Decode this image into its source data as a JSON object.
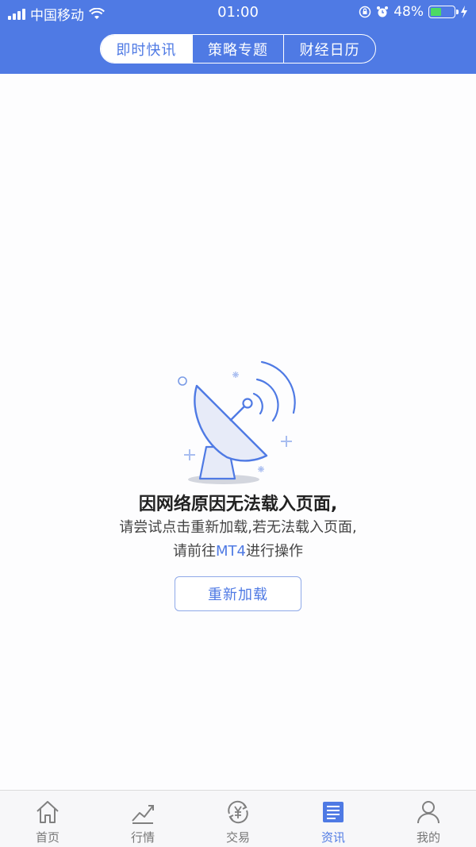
{
  "status_bar": {
    "carrier": "中国移动",
    "time": "01:00",
    "battery": "48%",
    "battery_level": 0.48,
    "icons": [
      "signal-icon",
      "wifi-icon",
      "orientation-lock-icon",
      "alarm-icon",
      "battery-icon",
      "charging-icon"
    ]
  },
  "tabs": [
    {
      "label": "即时快讯",
      "active": true
    },
    {
      "label": "策略专题",
      "active": false
    },
    {
      "label": "财经日历",
      "active": false
    }
  ],
  "empty_state": {
    "icon": "satellite-dish-icon",
    "title": "因网络原因无法载入页面,",
    "line1": "请尝试点击重新加载,若无法载入页面,",
    "line2_prefix": "请前往",
    "line2_highlight": "MT4",
    "line2_suffix": "进行操作",
    "reload_button": "重新加载"
  },
  "bottom_nav": [
    {
      "label": "首页",
      "icon": "home-icon",
      "active": false
    },
    {
      "label": "行情",
      "icon": "chart-icon",
      "active": false
    },
    {
      "label": "交易",
      "icon": "yuan-exchange-icon",
      "active": false
    },
    {
      "label": "资讯",
      "icon": "news-icon",
      "active": true
    },
    {
      "label": "我的",
      "icon": "user-icon",
      "active": false
    }
  ],
  "colors": {
    "primary": "#4f7ae4",
    "battery_green": "#4cd964"
  }
}
